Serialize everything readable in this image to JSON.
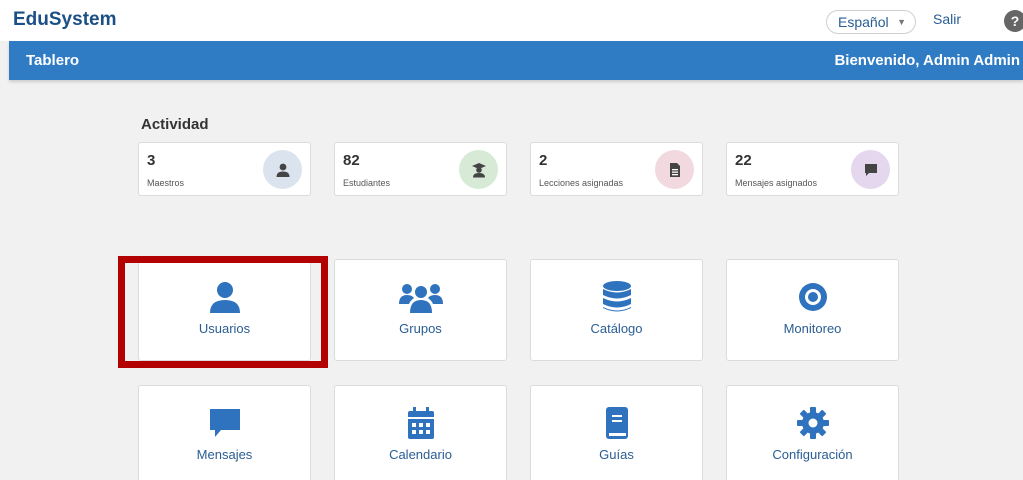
{
  "header": {
    "brand": "EduSystem",
    "language": "Español",
    "logout": "Salir",
    "help": "?"
  },
  "navbar": {
    "title": "Tablero",
    "welcome": "Bienvenido, Admin Admin"
  },
  "activity": {
    "title": "Actividad",
    "stats": [
      {
        "value": "3",
        "label": "Maestros",
        "icon": "teacher-icon",
        "bg": "#dbe4ee"
      },
      {
        "value": "82",
        "label": "Estudiantes",
        "icon": "graduate-icon",
        "bg": "#d6ead6"
      },
      {
        "value": "2",
        "label": "Lecciones asignadas",
        "icon": "document-icon",
        "bg": "#f1d9df"
      },
      {
        "value": "22",
        "label": "Mensajes asignados",
        "icon": "message-icon",
        "bg": "#e4d7ee"
      }
    ]
  },
  "modules": [
    {
      "label": "Usuarios",
      "icon": "user-icon"
    },
    {
      "label": "Grupos",
      "icon": "group-icon"
    },
    {
      "label": "Catálogo",
      "icon": "database-icon"
    },
    {
      "label": "Monitoreo",
      "icon": "eye-icon"
    },
    {
      "label": "Mensajes",
      "icon": "message-icon"
    },
    {
      "label": "Calendario",
      "icon": "calendar-icon"
    },
    {
      "label": "Guías",
      "icon": "book-icon"
    },
    {
      "label": "Configuración",
      "icon": "gear-icon"
    }
  ],
  "colors": {
    "primary": "#2f7cc5",
    "icon": "#2f72bd",
    "highlight": "#b30000"
  }
}
